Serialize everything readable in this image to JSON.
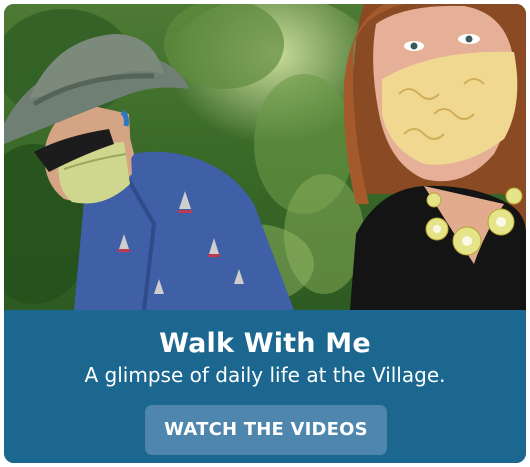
{
  "promo": {
    "title": "Walk With Me",
    "subtitle": "A glimpse of daily life at the Village.",
    "button_label": "WATCH THE VIDEOS"
  },
  "photo": {
    "subject": "two-people-walking-wearing-masks-photo"
  },
  "colors": {
    "banner": "#1b678f",
    "button": "#4f86ad",
    "text": "#ffffff"
  }
}
